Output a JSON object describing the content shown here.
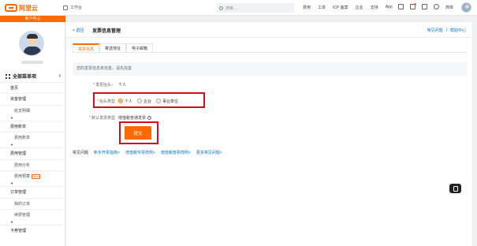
{
  "topbar": {
    "logo_text": "阿里云",
    "workbench": "工作台",
    "search_placeholder": "搜索...",
    "nav": [
      "费用",
      "工单",
      "ICP 备案",
      "企业",
      "支持",
      "App"
    ],
    "simple_label": "简体"
  },
  "sidebar": {
    "user_center": "用户中心",
    "all_menu": "全部菜单项",
    "items": [
      {
        "label": "首页",
        "type": "group"
      },
      {
        "label": "资金管理",
        "type": "group"
      },
      {
        "label": "收支明细",
        "type": "sub"
      },
      {
        "label": "",
        "type": "arrow"
      },
      {
        "label": "费用账单",
        "type": "group"
      },
      {
        "label": "费用账单",
        "type": "sub"
      },
      {
        "label": "",
        "type": "arrow"
      },
      {
        "label": "费用管理",
        "type": "group"
      },
      {
        "label": "费用分析",
        "type": "sub"
      },
      {
        "label": "费用预算",
        "type": "sub",
        "badge": "New"
      },
      {
        "label": "",
        "type": "arrow"
      },
      {
        "label": "订单管理",
        "type": "group"
      },
      {
        "label": "我的订单",
        "type": "sub"
      },
      {
        "label": "续费管理",
        "type": "sub"
      },
      {
        "label": "",
        "type": "arrow"
      },
      {
        "label": "卡券管理",
        "type": "group"
      }
    ]
  },
  "main": {
    "back": "< 返回",
    "title": "发票信息管理",
    "help_faq": "常见问题",
    "help_center": "帮助中心",
    "tabs": [
      "发票信息",
      "寄送地址",
      "电子邮箱"
    ],
    "notice": "您的发票信息未完善，请先完善",
    "form": {
      "title_label": "发票抬头：",
      "title_value": "个人",
      "type_label": "抬头类型",
      "type_options": [
        "个人",
        "企业",
        "事业单位"
      ],
      "type_selected": 0,
      "category_label": "默认发票类型",
      "category_value": "增值税普通发票",
      "info_icon": "?"
    },
    "submit": "提交",
    "faq": {
      "title": "常见问题",
      "links": [
        "新手开票指南>",
        "增值税专票样例>",
        "增值税普票样例>",
        "更多常见问题>"
      ]
    }
  },
  "colors": {
    "accent": "#ff6a00",
    "link": "#0070cc",
    "highlight_box": "#d0101d"
  }
}
